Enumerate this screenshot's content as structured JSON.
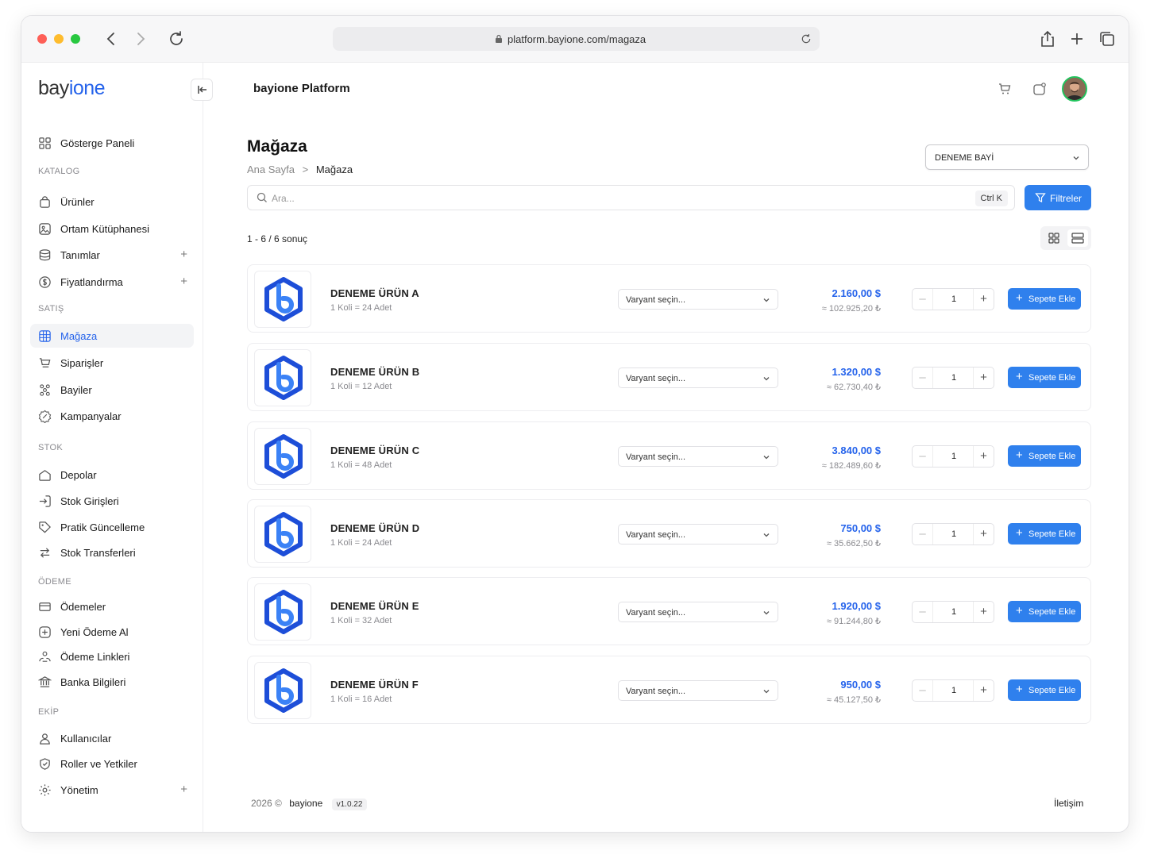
{
  "browser": {
    "url": "platform.bayione.com/magaza",
    "traffic_lights": {
      "close": "#fe5f57",
      "minimize": "#febc2e",
      "maximize": "#28c840"
    }
  },
  "brand": {
    "part1": "bay",
    "part2": "ione",
    "accent": "#2563eb"
  },
  "sidebar": {
    "dashboard": "Gösterge Paneli",
    "sections": {
      "katalog": "KATALOG",
      "satis": "SATIŞ",
      "stok": "STOK",
      "odeme": "ÖDEME",
      "ekip": "EKİP"
    },
    "items": {
      "urunler": "Ürünler",
      "ortam": "Ortam Kütüphanesi",
      "tanimlar": "Tanımlar",
      "fiyat": "Fiyatlandırma",
      "magaza": "Mağaza",
      "siparisler": "Siparişler",
      "bayiler": "Bayiler",
      "kampanyalar": "Kampanyalar",
      "depolar": "Depolar",
      "stok_giris": "Stok Girişleri",
      "pratik": "Pratik Güncelleme",
      "stok_transfer": "Stok Transferleri",
      "odemeler": "Ödemeler",
      "yeni_odeme": "Yeni Ödeme Al",
      "odeme_link": "Ödeme Linkleri",
      "banka": "Banka Bilgileri",
      "kullanicilar": "Kullanıcılar",
      "roller": "Roller ve Yetkiler",
      "yonetim": "Yönetim"
    }
  },
  "topbar": {
    "title": "bayione Platform"
  },
  "page": {
    "title": "Mağaza",
    "breadcrumb": {
      "home": "Ana Sayfa",
      "sep": ">",
      "current": "Mağaza"
    },
    "dealer_select": "DENEME BAYİ",
    "search_placeholder": "Ara...",
    "search_shortcut": "Ctrl K",
    "filter_label": "Filtreler",
    "result_count": "1 - 6 / 6 sonuç"
  },
  "products": [
    {
      "name": "DENEME ÜRÜN A",
      "pack": "1 Koli = 24 Adet",
      "variant": "Varyant seçin...",
      "price": "2.160,00 $",
      "price_try": "≈ 102.925,20 ₺",
      "qty": "1",
      "add": "Sepete Ekle"
    },
    {
      "name": "DENEME ÜRÜN B",
      "pack": "1 Koli = 12 Adet",
      "variant": "Varyant seçin...",
      "price": "1.320,00 $",
      "price_try": "≈ 62.730,40 ₺",
      "qty": "1",
      "add": "Sepete Ekle"
    },
    {
      "name": "DENEME ÜRÜN C",
      "pack": "1 Koli = 48 Adet",
      "variant": "Varyant seçin...",
      "price": "3.840,00 $",
      "price_try": "≈ 182.489,60 ₺",
      "qty": "1",
      "add": "Sepete Ekle"
    },
    {
      "name": "DENEME ÜRÜN D",
      "pack": "1 Koli = 24 Adet",
      "variant": "Varyant seçin...",
      "price": "750,00 $",
      "price_try": "≈ 35.662,50 ₺",
      "qty": "1",
      "add": "Sepete Ekle"
    },
    {
      "name": "DENEME ÜRÜN E",
      "pack": "1 Koli = 32 Adet",
      "variant": "Varyant seçin...",
      "price": "1.920,00 $",
      "price_try": "≈ 91.244,80 ₺",
      "qty": "1",
      "add": "Sepete Ekle"
    },
    {
      "name": "DENEME ÜRÜN F",
      "pack": "1 Koli = 16 Adet",
      "variant": "Varyant seçin...",
      "price": "950,00 $",
      "price_try": "≈ 45.127,50 ₺",
      "qty": "1",
      "add": "Sepete Ekle"
    }
  ],
  "footer": {
    "year": "2026 ©",
    "brand": "bayione",
    "version": "v1.0.22",
    "contact": "İletişim"
  }
}
